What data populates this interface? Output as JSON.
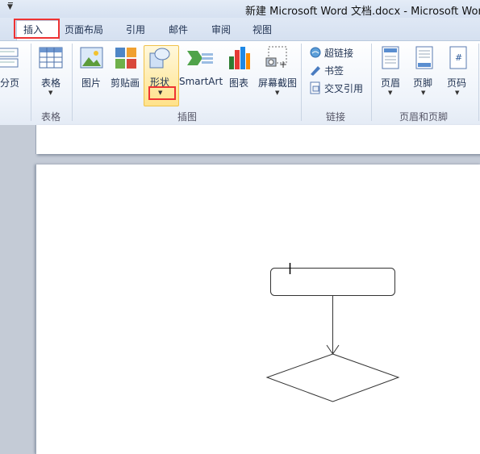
{
  "window": {
    "title": "新建 Microsoft Word 文档.docx  -  Microsoft Word"
  },
  "tabs": [
    {
      "label": "插入",
      "active": true
    },
    {
      "label": "页面布局"
    },
    {
      "label": "引用"
    },
    {
      "label": "邮件"
    },
    {
      "label": "审阅"
    },
    {
      "label": "视图"
    }
  ],
  "ribbon": {
    "pages_partial": {
      "button": "分页"
    },
    "table_group": {
      "label": "表格",
      "button": "表格"
    },
    "illustrations_group": {
      "label": "插图",
      "buttons": {
        "picture": "图片",
        "clipart": "剪贴画",
        "shapes": "形状",
        "smartart": "SmartArt",
        "chart": "图表",
        "screenshot": "屏幕截图"
      }
    },
    "links_group": {
      "label": "链接",
      "buttons": {
        "hyperlink": "超链接",
        "bookmark": "书签",
        "crossref": "交叉引用"
      }
    },
    "header_footer_group": {
      "label": "页眉和页脚",
      "buttons": {
        "header": "页眉",
        "footer": "页脚",
        "page_number": "页码"
      }
    }
  },
  "colors": {
    "highlight": "#e33333",
    "accent": "#1e3050"
  }
}
